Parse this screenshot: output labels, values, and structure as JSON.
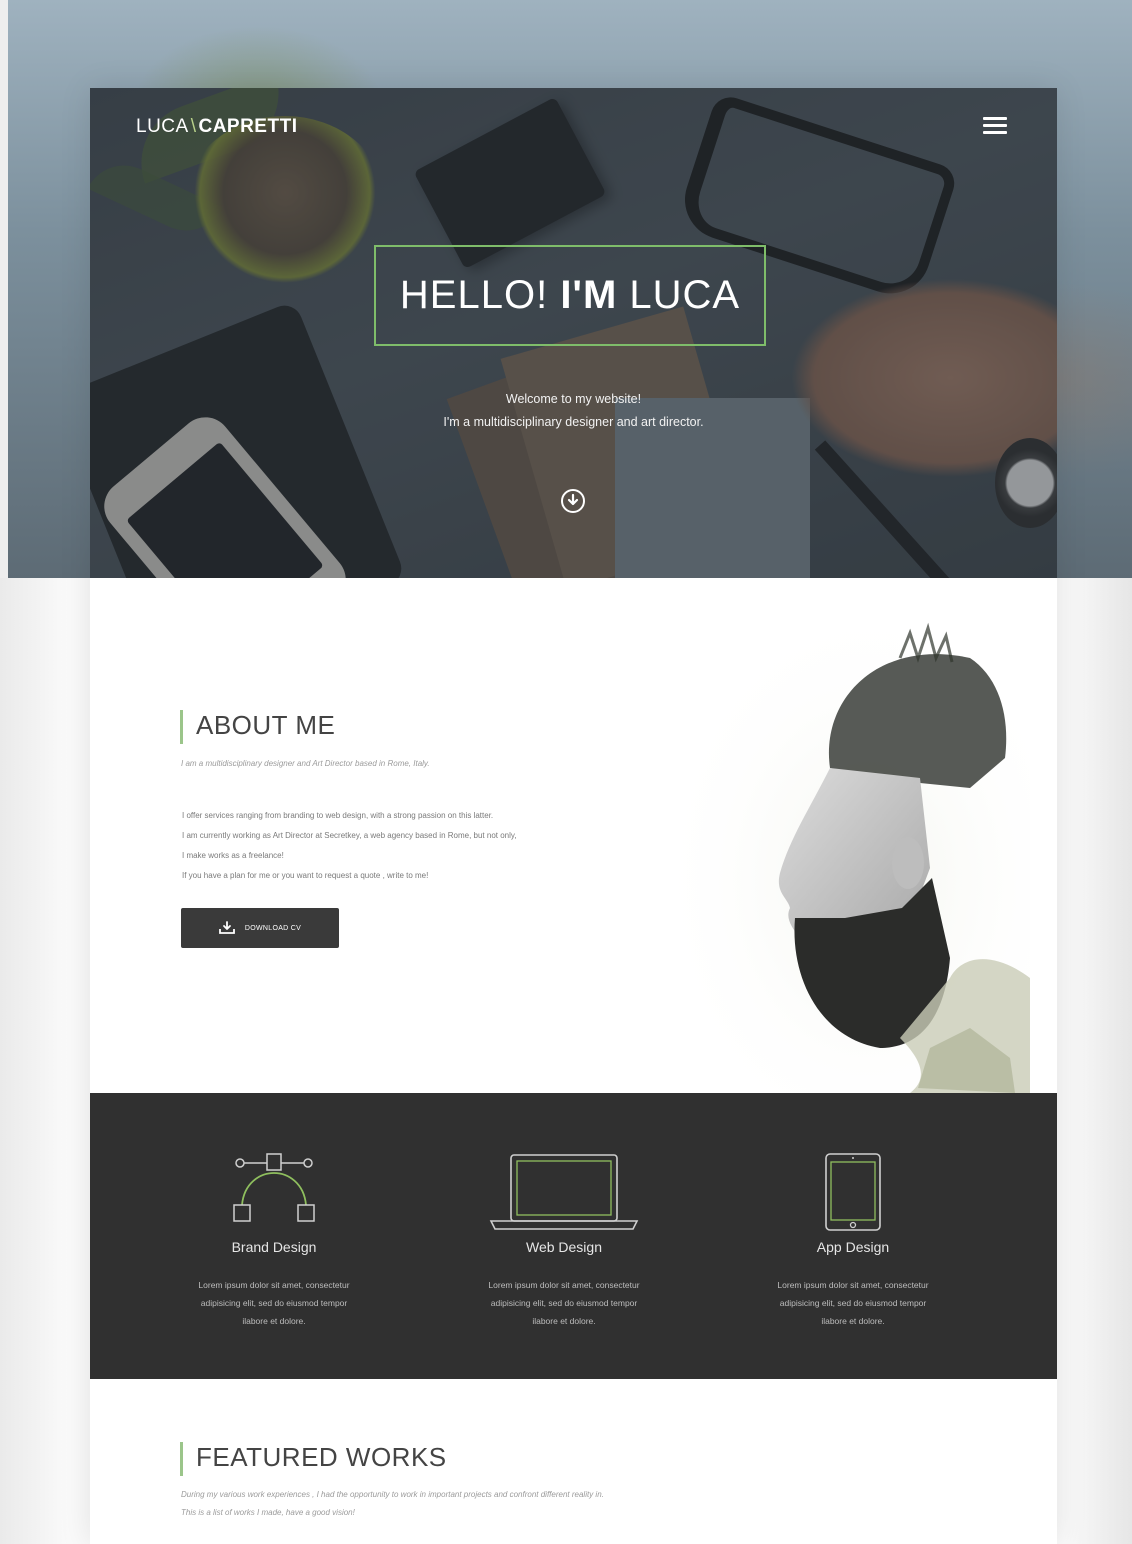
{
  "header": {
    "logo_first": "LUCA",
    "logo_slash": "\\",
    "logo_last": "CAPRETTI",
    "menu_icon": "hamburger-menu-icon"
  },
  "hero": {
    "title_normal": "HELLO! ",
    "title_bold": "I'M",
    "title_end": " LUCA",
    "subtitle_line1": "Welcome to my website!",
    "subtitle_line2": "I'm a multidisciplinary designer and art director.",
    "scroll_icon": "arrow-down-circle-icon"
  },
  "about": {
    "title": "ABOUT ME",
    "tagline": "I am a multidisciplinary designer and Art Director based in Rome, Italy.",
    "body": [
      "I offer services ranging from branding to web design, with a strong passion on this latter.",
      "I am currently working as Art Director at Secretkey, a web agency based in Rome, but not only,",
      "I make works as a freelance!",
      "If you have a plan for me or you want to request a quote , write to me!"
    ],
    "cv_button_label": "DOWNLOAD CV",
    "cv_icon": "download-tray-icon"
  },
  "services": [
    {
      "name": "Brand Design",
      "icon": "bezier-pen-icon",
      "desc_line1": "Lorem ipsum dolor sit amet, consectetur",
      "desc_line2": "adipisicing elit, sed do eiusmod tempor",
      "desc_line3": "ilabore et dolore."
    },
    {
      "name": "Web Design",
      "icon": "laptop-icon",
      "desc_line1": "Lorem ipsum dolor sit amet, consectetur",
      "desc_line2": "adipisicing elit, sed do eiusmod tempor",
      "desc_line3": "ilabore et dolore."
    },
    {
      "name": "App Design",
      "icon": "tablet-icon",
      "desc_line1": "Lorem ipsum dolor sit amet, consectetur",
      "desc_line2": "adipisicing elit, sed do eiusmod tempor",
      "desc_line3": "ilabore et dolore."
    }
  ],
  "featured": {
    "title": "FEATURED WORKS",
    "line1": "During my various work experiences , I had the opportunity to work in important projects and confront different reality in.",
    "line2": "This is a list of works I made, have a good vision!"
  },
  "colors": {
    "accent_green": "#7fbd6a",
    "dark_section": "#303030",
    "button_dark": "#3a3a3a"
  }
}
